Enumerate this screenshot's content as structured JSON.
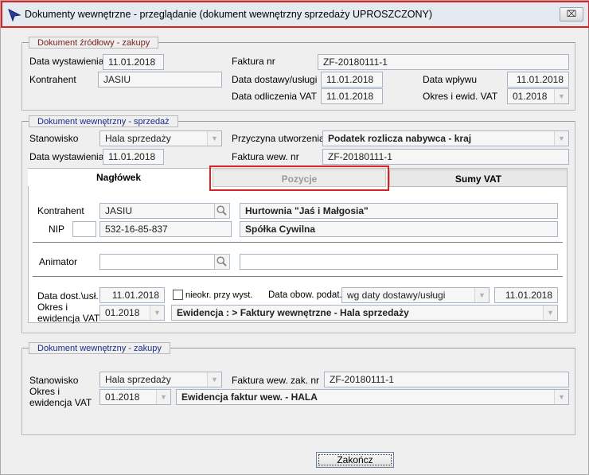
{
  "window": {
    "title": "Dokumenty wewnętrzne - przeglądanie (dokument wewnętrzny sprzedaży UPROSZCZONY)",
    "close_label": "⌧"
  },
  "source": {
    "legend": "Dokument źródłowy - zakupy",
    "issue_date_label": "Data wystawienia",
    "issue_date": "11.01.2018",
    "contractor_label": "Kontrahent",
    "contractor": "JASIU",
    "invoice_no_label": "Faktura nr",
    "invoice_no": "ZF-20180111-1",
    "delivery_date_label": "Data dostawy/usługi",
    "delivery_date": "11.01.2018",
    "receipt_date_label": "Data wpływu",
    "receipt_date": "11.01.2018",
    "vat_deduction_label": "Data odliczenia VAT",
    "vat_deduction_date": "11.01.2018",
    "vat_period_label": "Okres i ewid. VAT",
    "vat_period": "01.2018"
  },
  "sale": {
    "legend": "Dokument wewnętrzny - sprzedaż",
    "station_label": "Stanowisko",
    "station": "Hala sprzedaży",
    "reason_label": "Przyczyna utworzenia",
    "reason": "Podatek rozlicza nabywca - kraj",
    "issue_date_label": "Data wystawienia",
    "issue_date": "11.01.2018",
    "invoice_no_label": "Faktura wew. nr",
    "invoice_no": "ZF-20180111-1",
    "tabs": {
      "header": "Nagłówek",
      "items": "Pozycje",
      "vat_sums": "Sumy VAT"
    },
    "contractor_label": "Kontrahent",
    "contractor": "JASIU",
    "contractor_name": "Hurtownia \"Jaś i Małgosia\"",
    "nip_label": "NIP",
    "nip": "532-16-85-837",
    "company_type": "Spółka Cywilna",
    "animator_label": "Animator",
    "delivery_date_label": "Data dost.\\usł.",
    "delivery_date": "11.01.2018",
    "unspecified_label": "nieokr. przy wyst.",
    "tax_date_label": "Data obow. podat.",
    "tax_date_mode": "wg daty dostawy/usługi",
    "tax_date": "11.01.2018",
    "period_label_1": "Okres i",
    "period_label_2": "ewidencja VAT",
    "period": "01.2018",
    "register": "Ewidencja : > Faktury wewnętrzne - Hala sprzedaży"
  },
  "purchase": {
    "legend": "Dokument wewnętrzny - zakupy",
    "station_label": "Stanowisko",
    "station": "Hala sprzedaży",
    "invoice_label": "Faktura wew. zak. nr",
    "invoice_no": "ZF-20180111-1",
    "period_label_1": "Okres i",
    "period_label_2": "ewidencja VAT",
    "period": "01.2018",
    "register": "Ewidencja faktur wew. - HALA"
  },
  "footer": {
    "finish_label": "Zakończ"
  },
  "colors": {
    "highlight": "#e02020",
    "legend_maroon": "#7a2020",
    "legend_navy": "#1a2b8a"
  }
}
